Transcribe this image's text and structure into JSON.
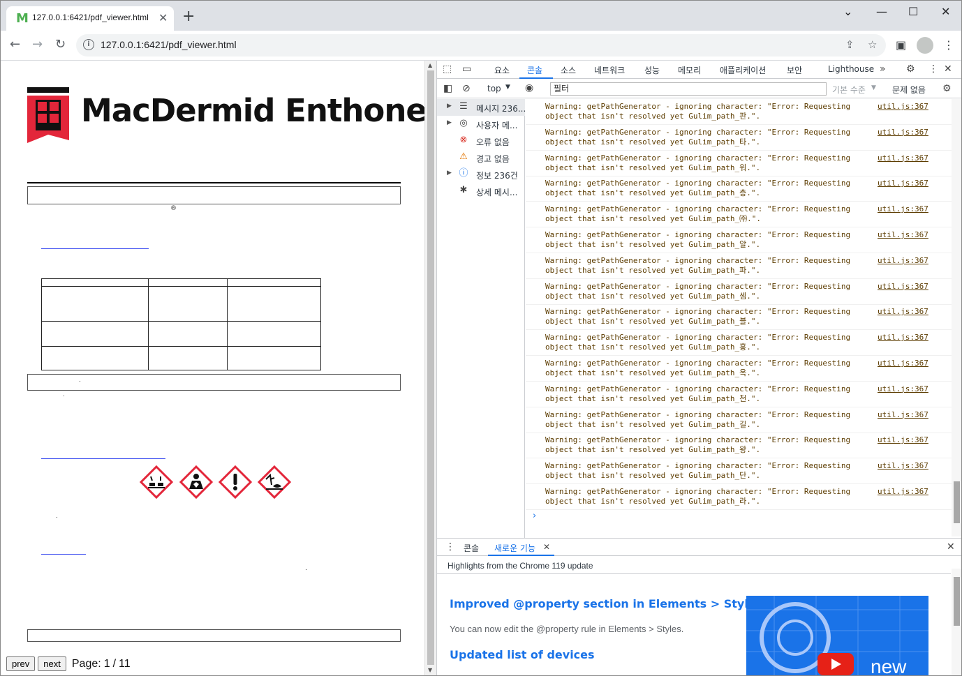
{
  "browser": {
    "tab_title": "127.0.0.1:6421/pdf_viewer.html",
    "url": "127.0.0.1:6421/pdf_viewer.html"
  },
  "pdf": {
    "logo_text": "MacDermid Enthone",
    "registered_mark": "®",
    "pager": {
      "prev_label": "prev",
      "next_label": "next",
      "page_label": "Page:",
      "current_page": "1",
      "separator": "/",
      "total_pages": "11"
    }
  },
  "devtools": {
    "tabs": [
      "요소",
      "콘솔",
      "소스",
      "네트워크",
      "성능",
      "메모리",
      "애플리케이션",
      "보안",
      "Lighthouse"
    ],
    "active_tab": "콘솔",
    "context": "top",
    "filter_placeholder": "필터",
    "levels_label": "기본 수준",
    "issues_label": "문제 없음",
    "sidebar": [
      {
        "label": "메시지 236...",
        "icon": "list-icon",
        "expandable": true
      },
      {
        "label": "사용자 메...",
        "icon": "user-icon",
        "expandable": true
      },
      {
        "label": "오류 없음",
        "icon": "error-icon",
        "expandable": false
      },
      {
        "label": "경고 없음",
        "icon": "warning-icon",
        "expandable": false
      },
      {
        "label": "정보 236건",
        "icon": "info-icon",
        "expandable": true
      },
      {
        "label": "상세 메시...",
        "icon": "bug-icon",
        "expandable": false
      }
    ],
    "messages": [
      {
        "line1": "Warning: getPathGenerator - ignoring character: \"Error: Requesting",
        "line2": "object that isn't resolved yet Gulim_path_판.\".",
        "source": "util.js:367"
      },
      {
        "line1": "Warning: getPathGenerator - ignoring character: \"Error: Requesting",
        "line2": "object that isn't resolved yet Gulim_path_타.\".",
        "source": "util.js:367"
      },
      {
        "line1": "Warning: getPathGenerator - ignoring character: \"Error: Requesting",
        "line2": "object that isn't resolved yet Gulim_path_워.\".",
        "source": "util.js:367"
      },
      {
        "line1": "Warning: getPathGenerator - ignoring character: \"Error: Requesting",
        "line2": "object that isn't resolved yet Gulim_path_층.\".",
        "source": "util.js:367"
      },
      {
        "line1": "Warning: getPathGenerator - ignoring character: \"Error: Requesting",
        "line2": "object that isn't resolved yet Gulim_path_㈜.\".",
        "source": "util.js:367"
      },
      {
        "line1": "Warning: getPathGenerator - ignoring character: \"Error: Requesting",
        "line2": "object that isn't resolved yet Gulim_path_알.\".",
        "source": "util.js:367"
      },
      {
        "line1": "Warning: getPathGenerator - ignoring character: \"Error: Requesting",
        "line2": "object that isn't resolved yet Gulim_path_파.\".",
        "source": "util.js:367"
      },
      {
        "line1": "Warning: getPathGenerator - ignoring character: \"Error: Requesting",
        "line2": "object that isn't resolved yet Gulim_path_셈.\".",
        "source": "util.js:367"
      },
      {
        "line1": "Warning: getPathGenerator - ignoring character: \"Error: Requesting",
        "line2": "object that isn't resolved yet Gulim_path_블.\".",
        "source": "util.js:367"
      },
      {
        "line1": "Warning: getPathGenerator - ignoring character: \"Error: Requesting",
        "line2": "object that isn't resolved yet Gulim_path_홍.\".",
        "source": "util.js:367"
      },
      {
        "line1": "Warning: getPathGenerator - ignoring character: \"Error: Requesting",
        "line2": "object that isn't resolved yet Gulim_path_옥.\".",
        "source": "util.js:367"
      },
      {
        "line1": "Warning: getPathGenerator - ignoring character: \"Error: Requesting",
        "line2": "object that isn't resolved yet Gulim_path_천.\".",
        "source": "util.js:367"
      },
      {
        "line1": "Warning: getPathGenerator - ignoring character: \"Error: Requesting",
        "line2": "object that isn't resolved yet Gulim_path_길.\".",
        "source": "util.js:367"
      },
      {
        "line1": "Warning: getPathGenerator - ignoring character: \"Error: Requesting",
        "line2": "object that isn't resolved yet Gulim_path_왕.\".",
        "source": "util.js:367"
      },
      {
        "line1": "Warning: getPathGenerator - ignoring character: \"Error: Requesting",
        "line2": "object that isn't resolved yet Gulim_path_단.\".",
        "source": "util.js:367"
      },
      {
        "line1": "Warning: getPathGenerator - ignoring character: \"Error: Requesting",
        "line2": "object that isn't resolved yet Gulim_path_라.\".",
        "source": "util.js:367"
      }
    ],
    "prompt": "›",
    "drawer": {
      "tabs": [
        "콘솔",
        "새로운 기능"
      ],
      "active_tab": "새로운 기능",
      "highlights": "Highlights from the Chrome 119 update",
      "feature1_title": "Improved @property section in Elements > Styles",
      "feature1_desc": "You can now edit the @property rule in Elements > Styles.",
      "feature2_title": "Updated list of devices",
      "video_badge": "new"
    }
  },
  "colors": {
    "accent": "#1a73e8",
    "logo_red": "#e3263a",
    "warn_text": "#5c3c00"
  }
}
